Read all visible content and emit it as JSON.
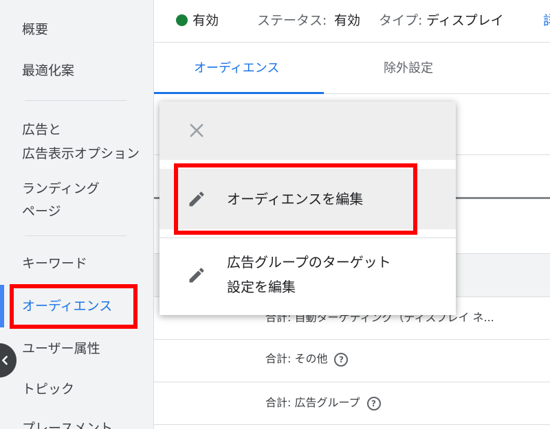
{
  "sidebar": {
    "items": [
      {
        "label": "概要"
      },
      {
        "label": "最適化案"
      },
      {
        "label_line1": "広告と",
        "label_line2": "広告表示オプション"
      },
      {
        "label_line1": "ランディング",
        "label_line2": "ページ"
      },
      {
        "label": "キーワード"
      },
      {
        "label": "オーディエンス",
        "active": true
      },
      {
        "label": "ユーザー属性"
      },
      {
        "label": "トピック"
      },
      {
        "label": "プレースメント"
      }
    ],
    "accent_color": "#4285f4"
  },
  "header": {
    "status_icon": "green-dot-icon",
    "status": "有効",
    "status_prefix": "ステータス:",
    "status_value": "有効",
    "type_prefix": "タイプ:",
    "type_value": "ディスプレイ",
    "link_fragment": "詳"
  },
  "tabs": [
    {
      "label": "オーディエンス",
      "active": true
    },
    {
      "label": "除外設定",
      "active": false
    }
  ],
  "rows": [
    {
      "text": "合計: 自動ターゲティング（ディスプレイ ネ..."
    },
    {
      "text": "合計: その他",
      "help_icon": "?"
    },
    {
      "text": "合計: 広告グループ",
      "help_icon": "?"
    }
  ],
  "menu": {
    "close_icon": "close-icon",
    "items": [
      {
        "icon": "pencil-icon",
        "label": "オーディエンスを編集",
        "highlighted": true
      },
      {
        "icon": "pencil-icon",
        "label_line1": "広告グループのターゲット",
        "label_line2": "設定を編集"
      }
    ]
  },
  "colors": {
    "link": "#1a73e8",
    "status_green": "#188038",
    "annotation_red": "#ff0000"
  }
}
